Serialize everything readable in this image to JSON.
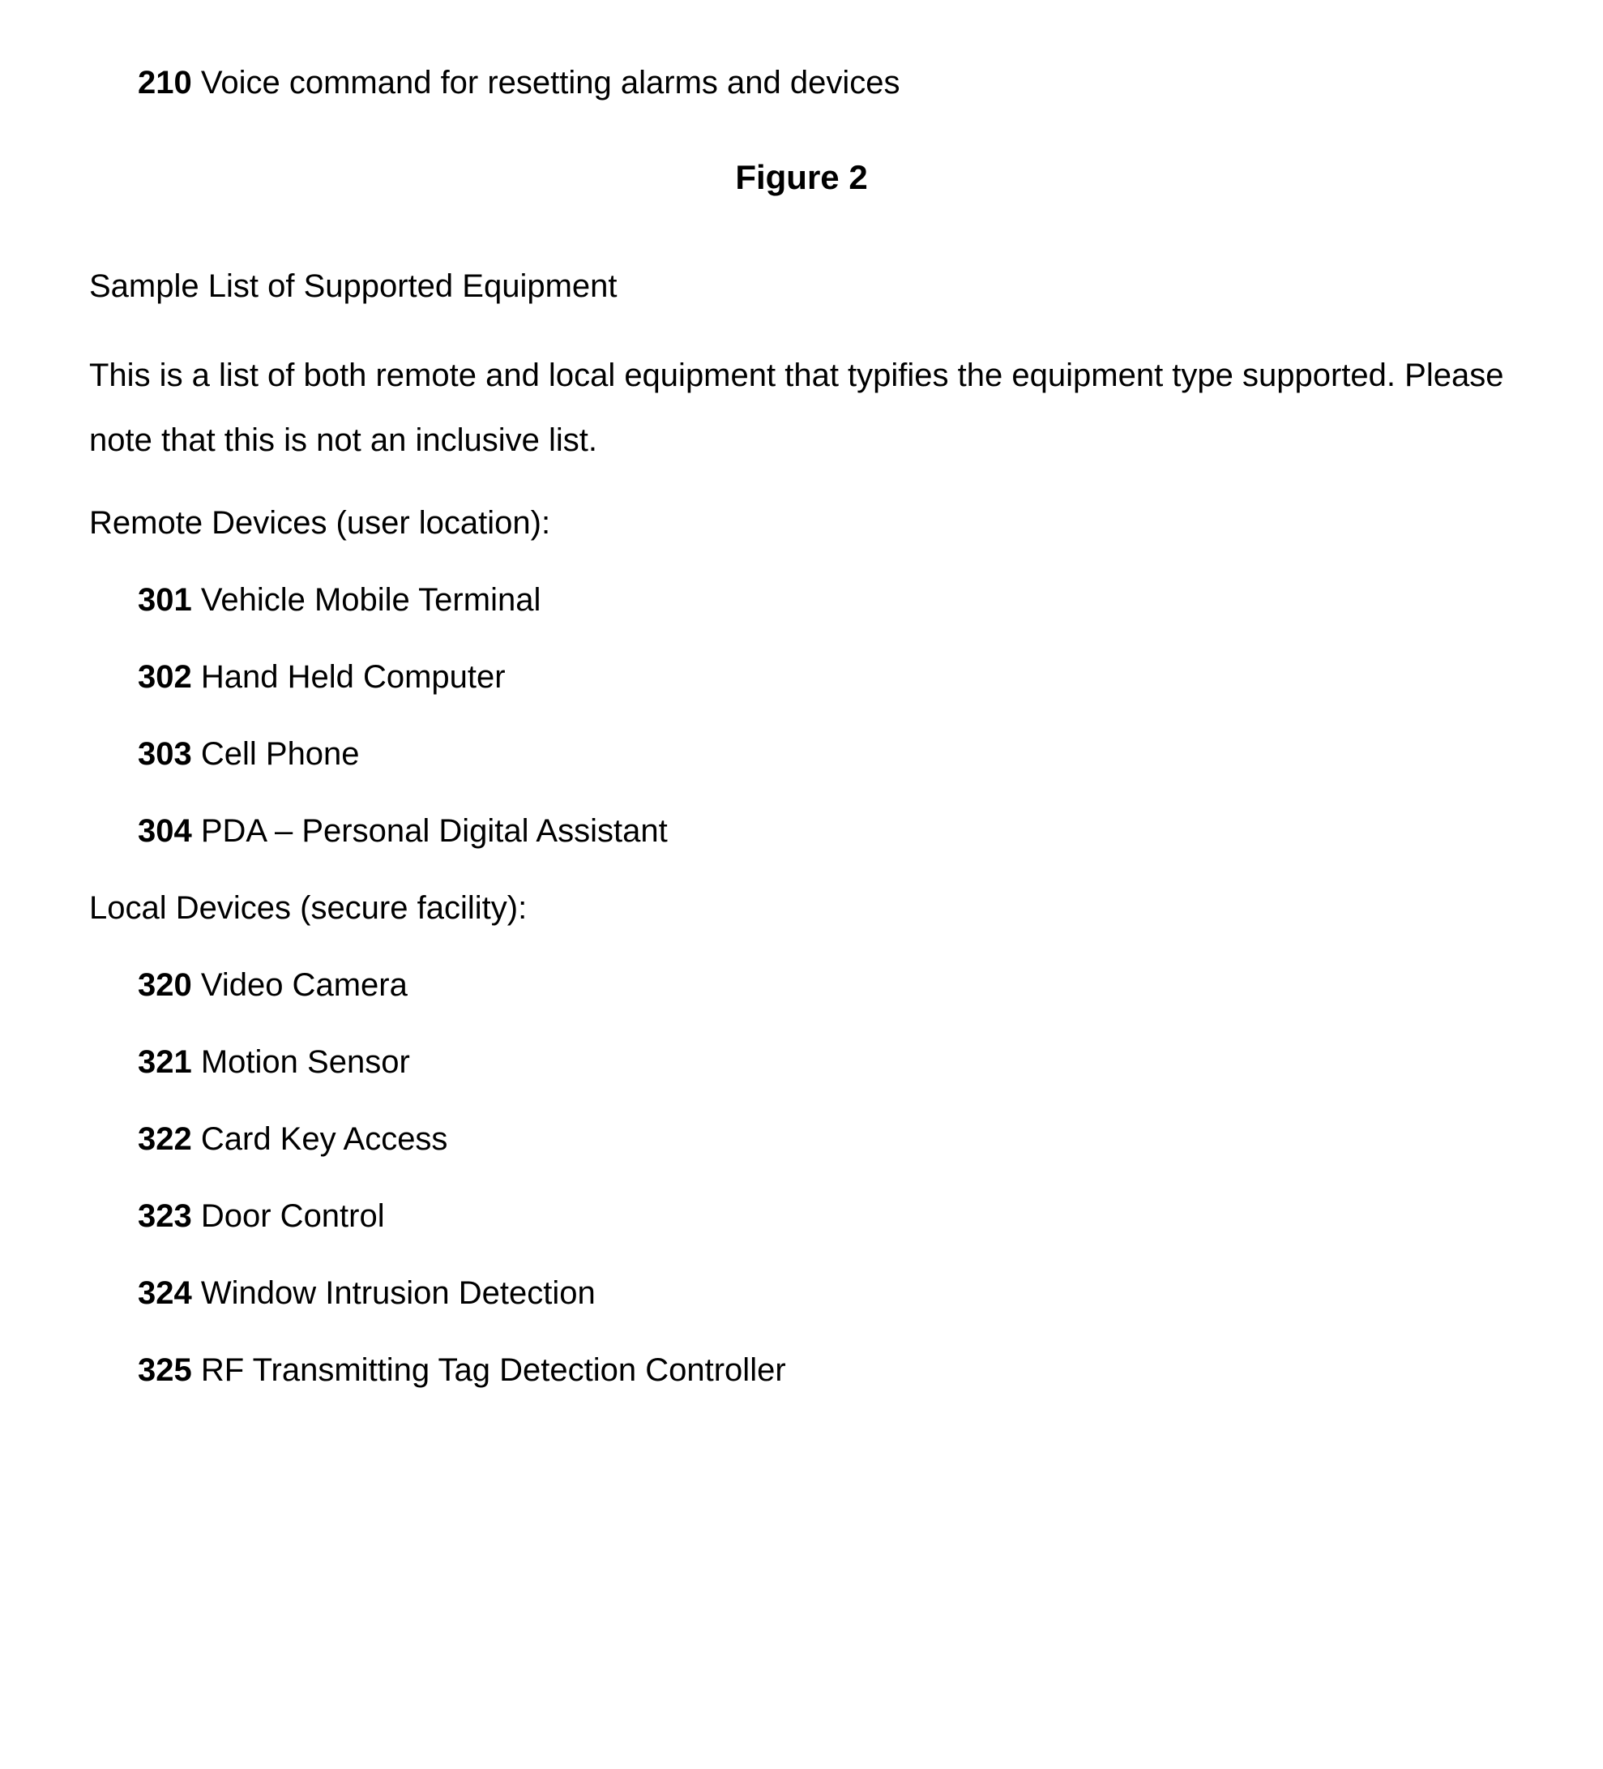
{
  "top_item": {
    "ref": "210",
    "text": " Voice command for resetting alarms and devices"
  },
  "figure_title": "Figure 2",
  "intro_title": "Sample List of Supported Equipment",
  "intro_body": "This is a list of both remote and local equipment that typifies the equipment type supported.  Please note that this is not an inclusive list.",
  "remote_label": "Remote Devices (user location):",
  "remote_items": [
    {
      "ref": "301",
      "text": " Vehicle Mobile Terminal"
    },
    {
      "ref": "302",
      "text": " Hand Held Computer"
    },
    {
      "ref": "303",
      "text": " Cell Phone"
    },
    {
      "ref": "304",
      "text": " PDA – Personal Digital Assistant"
    }
  ],
  "local_label": "Local Devices (secure facility):",
  "local_items": [
    {
      "ref": "320",
      "text": " Video Camera"
    },
    {
      "ref": "321",
      "text": " Motion Sensor"
    },
    {
      "ref": "322",
      "text": " Card Key Access"
    },
    {
      "ref": "323",
      "text": " Door Control"
    },
    {
      "ref": "324",
      "text": " Window Intrusion Detection"
    },
    {
      "ref": "325",
      "text": " RF Transmitting Tag Detection Controller"
    }
  ]
}
